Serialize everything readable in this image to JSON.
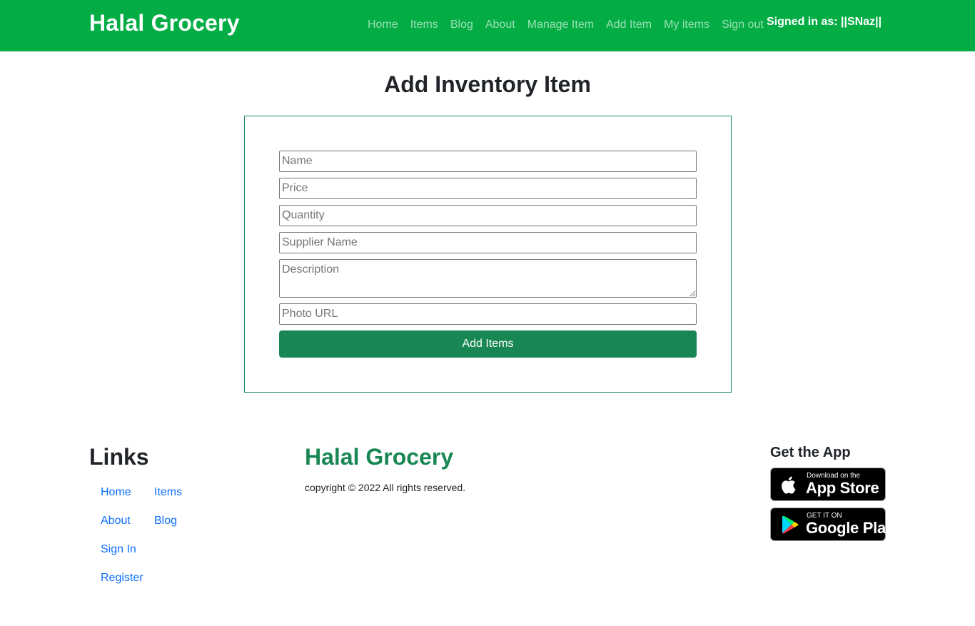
{
  "navbar": {
    "brand": "Halal Grocery",
    "links": [
      "Home",
      "Items",
      "Blog",
      "About",
      "Manage Item",
      "Add Item",
      "My items",
      "Sign out"
    ],
    "signed_in": "Signed in as: ||SNaz||"
  },
  "main": {
    "title": "Add Inventory Item",
    "form": {
      "name_placeholder": "Name",
      "price_placeholder": "Price",
      "quantity_placeholder": "Quantity",
      "supplier_placeholder": "Supplier Name",
      "description_placeholder": "Description",
      "photo_placeholder": "Photo URL",
      "submit_label": "Add Items"
    }
  },
  "footer": {
    "links_title": "Links",
    "links": [
      "Home",
      "Items",
      "About",
      "Blog",
      "Sign In",
      "Register"
    ],
    "brand": "Halal Grocery",
    "copyright": "copyright © 2022 All rights reserved.",
    "app_title": "Get the App",
    "app_store": {
      "small": "Download on the",
      "big": "App Store"
    },
    "google_play": {
      "small": "GET IT ON",
      "big": "Google Play"
    }
  },
  "colors": {
    "navbar": "#03ad44",
    "accent": "#198754",
    "link": "#0d6efd"
  },
  "icons": [
    "apple-icon",
    "google-play-icon"
  ]
}
